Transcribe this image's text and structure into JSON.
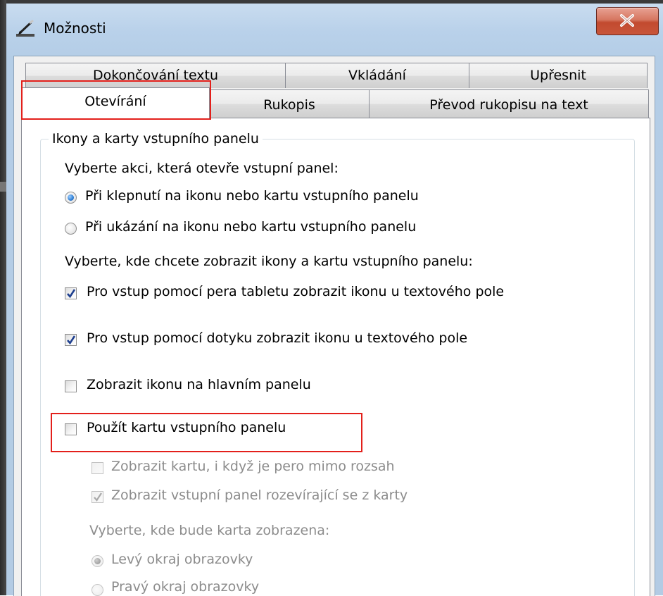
{
  "window": {
    "title": "Možnosti",
    "close_glyph": "X",
    "accent_highlight": "#e3201b"
  },
  "tabs": {
    "row1": [
      {
        "label": "Dokončování textu"
      },
      {
        "label": "Vkládání"
      },
      {
        "label": "Upřesnit"
      }
    ],
    "row2": [
      {
        "label": "Otevírání",
        "selected": true
      },
      {
        "label": "Rukopis"
      },
      {
        "label": "Převod rukopisu na text"
      }
    ]
  },
  "group": {
    "legend": "Ikony a karty vstupního panelu",
    "prompt_open": "Vyberte akci, která otevře vstupní panel:",
    "radio_open": [
      {
        "label": "Při klepnutí na ikonu nebo kartu vstupního panelu",
        "selected": true
      },
      {
        "label": "Při ukázání na ikonu nebo kartu vstupního panelu",
        "selected": false
      }
    ],
    "prompt_where": "Vyberte, kde chcete zobrazit ikony a kartu vstupního panelu:",
    "checkboxes": [
      {
        "label": "Pro vstup pomocí pera tabletu zobrazit ikonu u textového pole",
        "checked": true
      },
      {
        "label": "Pro vstup pomocí dotyku zobrazit ikonu u textového pole",
        "checked": true
      },
      {
        "label": "Zobrazit ikonu na hlavním panelu",
        "checked": false
      },
      {
        "label": "Použít kartu vstupního panelu",
        "checked": false
      }
    ],
    "sub_checkboxes": [
      {
        "label": "Zobrazit kartu, i když je pero mimo rozsah",
        "checked": false,
        "enabled": false
      },
      {
        "label": "Zobrazit vstupní panel rozevírající se z karty",
        "checked": true,
        "enabled": false
      }
    ],
    "prompt_tab_position": "Vyberte, kde bude karta zobrazena:",
    "radio_position": [
      {
        "label": "Levý okraj obrazovky",
        "selected": true,
        "enabled": false
      },
      {
        "label": "Pravý okraj obrazovky",
        "selected": false,
        "enabled": false
      }
    ]
  }
}
